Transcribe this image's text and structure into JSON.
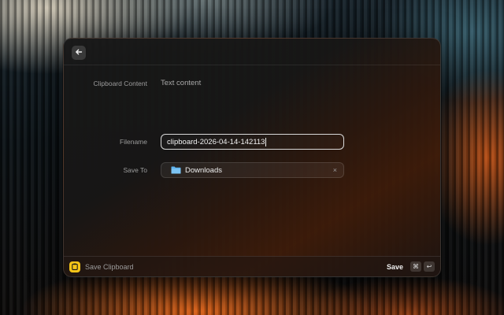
{
  "form": {
    "clipboard_content": {
      "label": "Clipboard Content",
      "value": "Text content"
    },
    "filename": {
      "label": "Filename",
      "value": "clipboard-2026-04-14-142113"
    },
    "save_to": {
      "label": "Save To",
      "value": "Downloads",
      "clear": "×"
    }
  },
  "footer": {
    "title": "Save Clipboard",
    "action": "Save",
    "shortcut": [
      "⌘",
      "↩"
    ]
  },
  "icons": {
    "back": "arrow-left-icon",
    "folder": "folder-icon",
    "app": "clipboard-icon"
  },
  "colors": {
    "accent": "#f5c518",
    "folder": "#5fb3ee"
  }
}
